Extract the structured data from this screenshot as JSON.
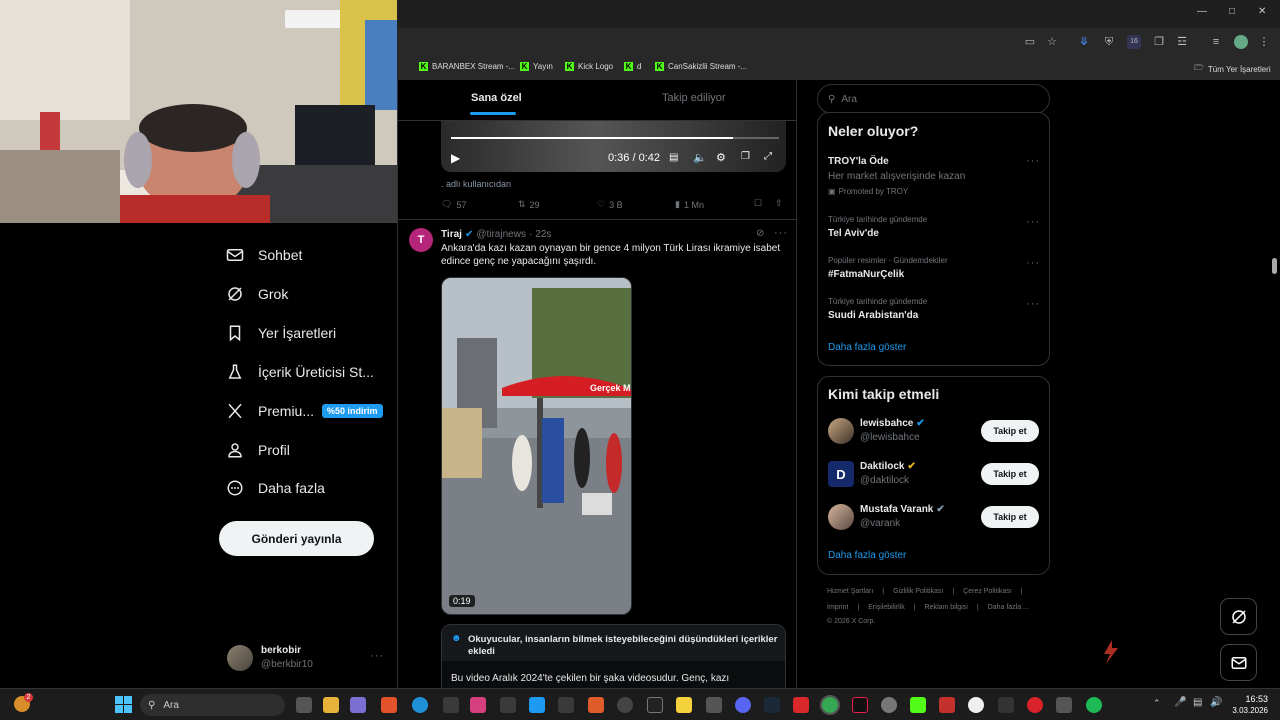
{
  "browser": {
    "bookmarks": [
      {
        "label": "BARANBEX Stream -..."
      },
      {
        "label": "Yayın"
      },
      {
        "label": "Kick Logo"
      },
      {
        "label": "d"
      },
      {
        "label": "CanSakizlii Stream -..."
      }
    ],
    "all_bookmarks": "Tüm Yer İşaretleri",
    "extension_badge": "16"
  },
  "nav": {
    "items": [
      {
        "label": "Sohbet",
        "icon": "mail-icon"
      },
      {
        "label": "Grok",
        "icon": "grok-icon"
      },
      {
        "label": "Yer İşaretleri",
        "icon": "bookmark-icon"
      },
      {
        "label": "İçerik Üreticisi St...",
        "icon": "flask-icon"
      },
      {
        "label": "Premiu...",
        "icon": "x-icon"
      },
      {
        "label": "Profil",
        "icon": "person-icon"
      },
      {
        "label": "Daha fazla",
        "icon": "more-circle-icon"
      }
    ],
    "premium_badge": "%50 indirim",
    "post_button": "Gönderi yayınla",
    "account": {
      "name": "berkobir",
      "handle": "@berkbir10"
    }
  },
  "feed": {
    "tabs": [
      "Sana özel",
      "Takip ediliyor"
    ],
    "video1": {
      "time": "0:36 / 0:42",
      "caption": ". adlı kullanıcıdan",
      "progress": 0.86
    },
    "tweet1_stats": {
      "replies": "57",
      "reposts": "29",
      "likes": "3 B",
      "views": "1 Mn"
    },
    "tweet2": {
      "name": "Tiraj",
      "handle": "@tirajnews",
      "time": "22s",
      "text": "Ankara'da kazı kazan oynayan bir gence 4 milyon Türk Lirası ikramiye isabet edince genç ne yapacağını şaşırdı.",
      "video_duration": "0:19",
      "umbrella_text": "Gerçek Mu",
      "note_title": "Okuyucular, insanların bilmek isteyebileceğini düşündükleri içerikler ekledi",
      "note_text": "Bu video Aralık 2024'te çekilen bir şaka videosudur. Genç, kazı"
    }
  },
  "sidebar": {
    "search_placeholder": "Ara",
    "trends_title": "Neler oluyor?",
    "promoted": {
      "title": "TROY'la Öde",
      "desc": "Her market alışverişinde kazan",
      "label": "Promoted by TROY"
    },
    "trends": [
      {
        "context": "Türkiye tarihinde gündemde",
        "title": "Tel Aviv'de"
      },
      {
        "context": "Popüler resimler · Gündemdekiler",
        "title": "#FatmaNurÇelik"
      },
      {
        "context": "Türkiye tarihinde gündemde",
        "title": "Suudi Arabistan'da"
      }
    ],
    "show_more": "Daha fazla göster",
    "who_title": "Kimi takip etmeli",
    "who": [
      {
        "name": "lewisbahce",
        "handle": "@lewisbahce",
        "verified_color": "#1d9bf0"
      },
      {
        "name": "Daktilock",
        "handle": "@daktilock",
        "verified_color": "#e2b719"
      },
      {
        "name": "Mustafa Varank",
        "handle": "@varank",
        "verified_color": "#829aab"
      }
    ],
    "follow_label": "Takip et",
    "who_show_more": "Daha fazla göster",
    "footer_line1": [
      "Hizmet Şartları",
      "Gizlilik Politikası",
      "Çerez Politikası"
    ],
    "footer_line2": [
      "İmprint",
      "Erişilebilirlik",
      "Reklam bilgisi",
      "Daha fazla ..."
    ],
    "copyright": "© 2026 X Corp."
  },
  "taskbar": {
    "search": "Ara",
    "time": "16:53",
    "date": "3.03.2026",
    "notification_count": "2"
  },
  "colors": {
    "accent": "#1d9bf0",
    "background": "#000000",
    "kick_green": "#53fc18"
  }
}
